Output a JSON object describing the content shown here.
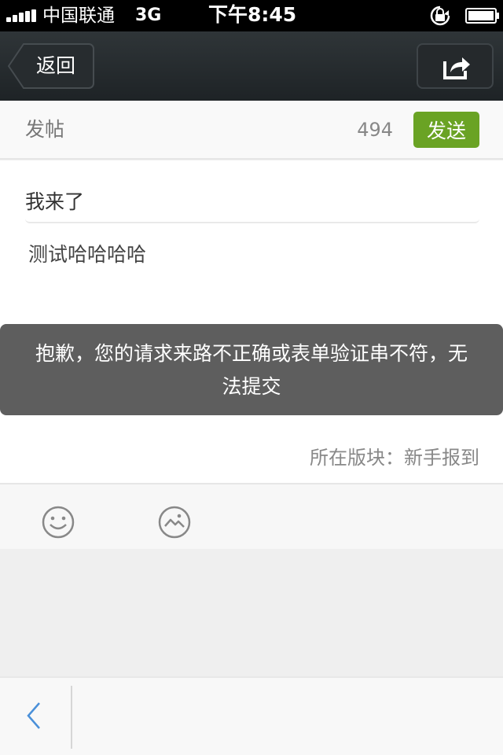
{
  "status_bar": {
    "carrier": "中国联通",
    "network": "3G",
    "time": "下午8:45"
  },
  "nav": {
    "back_label": "返回",
    "share_icon": "share-icon"
  },
  "compose_header": {
    "title": "发帖",
    "remaining_chars": "494",
    "send_label": "发送"
  },
  "compose": {
    "subject_value": "我来了",
    "body_text": "测试哈哈哈哈",
    "forum_label": "所在版块：新手报到"
  },
  "toast": {
    "message": "抱歉，您的请求来路不正确或表单验证串不符，无法提交"
  },
  "toolbar": {
    "emoji_icon": "smiley-icon",
    "image_icon": "image-icon"
  },
  "colors": {
    "send_button": "#6aa324",
    "nav_bar": "#2a2f32",
    "toast_bg": "#505050",
    "back_arrow": "#4a90d9"
  }
}
